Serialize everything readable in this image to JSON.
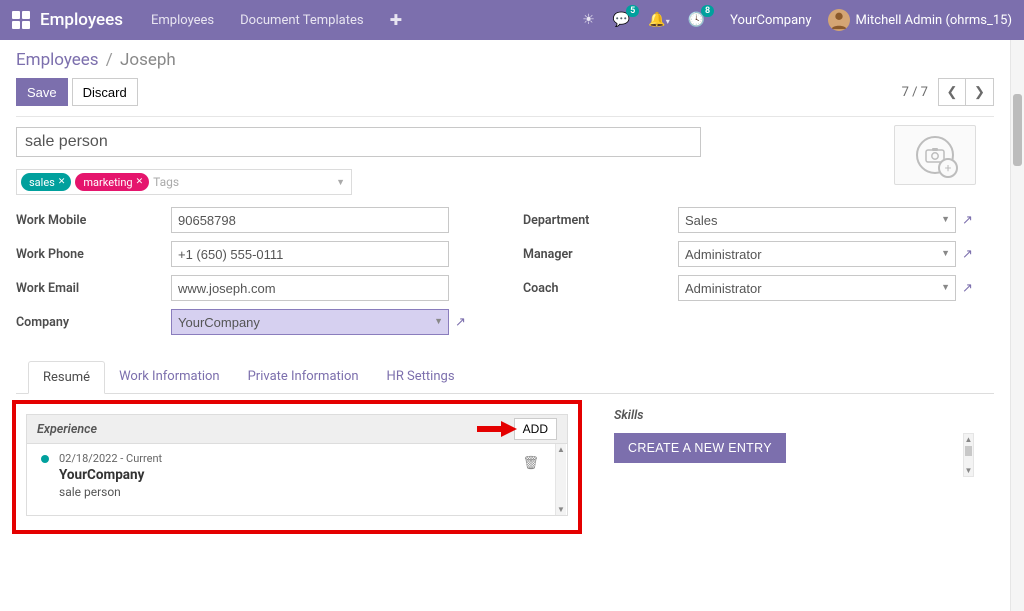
{
  "topbar": {
    "brand": "Employees",
    "nav": {
      "employees": "Employees",
      "templates": "Document Templates"
    },
    "messages_badge": "5",
    "activities_badge": "8",
    "company": "YourCompany",
    "user": "Mitchell Admin (ohrms_15)"
  },
  "breadcrumb": {
    "root": "Employees",
    "sep": "/",
    "current": "Joseph"
  },
  "actions": {
    "save": "Save",
    "discard": "Discard",
    "pager": "7 / 7"
  },
  "form": {
    "title": "sale person",
    "tags": {
      "sales": "sales",
      "marketing": "marketing",
      "placeholder": "Tags"
    },
    "labels": {
      "work_mobile": "Work Mobile",
      "work_phone": "Work Phone",
      "work_email": "Work Email",
      "company": "Company",
      "department": "Department",
      "manager": "Manager",
      "coach": "Coach"
    },
    "values": {
      "work_mobile": "90658798",
      "work_phone": "+1 (650) 555-0111",
      "work_email": "www.joseph.com",
      "company": "YourCompany",
      "department": "Sales",
      "manager": "Administrator",
      "coach": "Administrator"
    }
  },
  "tabs": {
    "resume": "Resumé",
    "work_info": "Work Information",
    "private_info": "Private Information",
    "hr_settings": "HR Settings"
  },
  "resume": {
    "experience_title": "Experience",
    "add": "ADD",
    "entry": {
      "dates": "02/18/2022 - Current",
      "org": "YourCompany",
      "role": "sale person"
    },
    "skills_title": "Skills",
    "create_entry": "CREATE A NEW ENTRY"
  }
}
